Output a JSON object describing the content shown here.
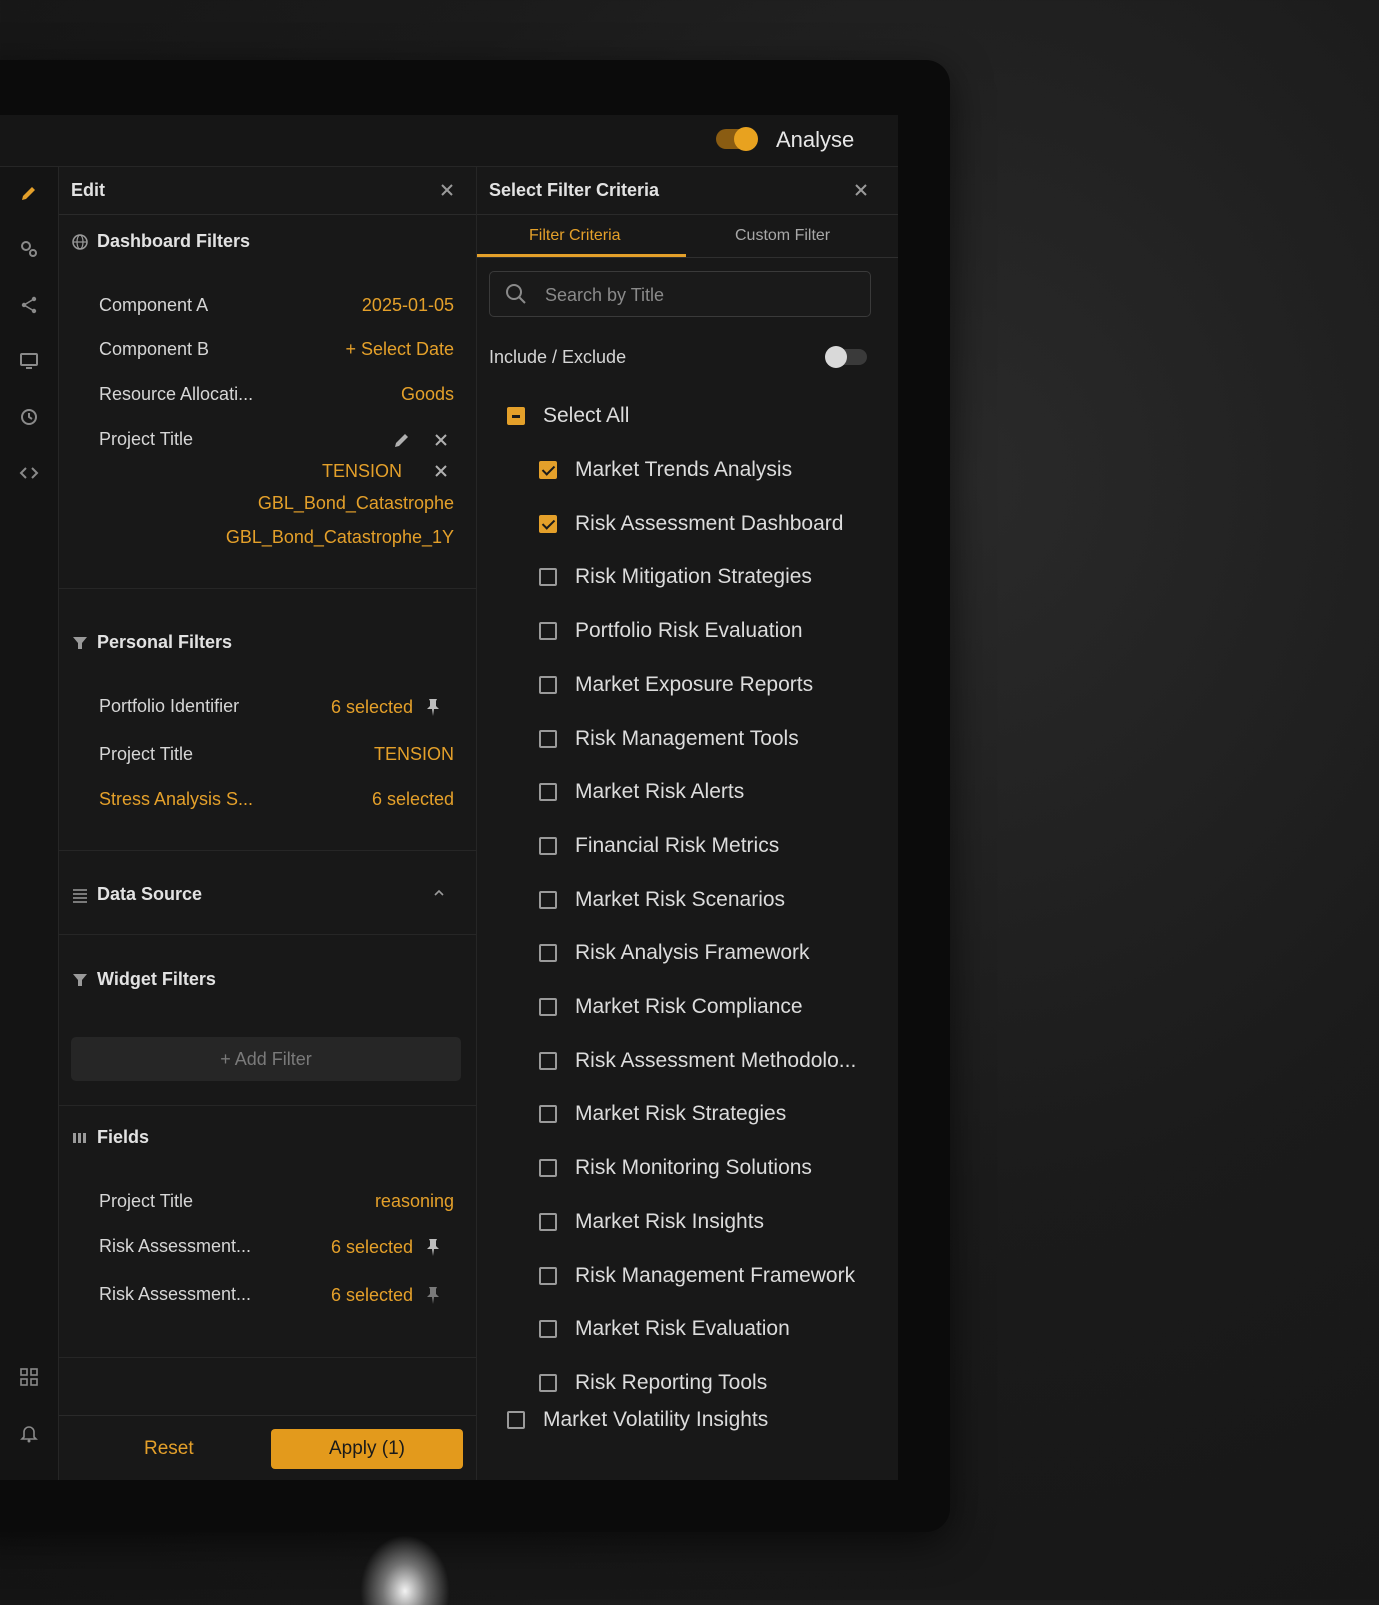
{
  "header": {
    "analyse_label": "Analyse"
  },
  "edit_panel": {
    "title": "Edit",
    "dashboard_filters": {
      "title": "Dashboard Filters",
      "rows": [
        {
          "label": "Component A",
          "value": "2025-01-05"
        },
        {
          "label": "Component B",
          "value": "+ Select Date"
        },
        {
          "label": "Resource Allocati...",
          "value": "Goods"
        },
        {
          "label": "Project Title",
          "values": [
            "TENSION",
            "GBL_Bond_Catastrophe",
            "GBL_Bond_Catastrophe_1Y"
          ]
        }
      ]
    },
    "personal_filters": {
      "title": "Personal Filters",
      "rows": [
        {
          "label": "Portfolio Identifier",
          "value": "6 selected"
        },
        {
          "label": "Project Title",
          "value": "TENSION"
        },
        {
          "label": "Stress Analysis S...",
          "value": "6 selected"
        }
      ]
    },
    "data_source": {
      "title": "Data Source"
    },
    "widget_filters": {
      "title": "Widget Filters",
      "add_label": "+ Add Filter"
    },
    "fields": {
      "title": "Fields",
      "rows": [
        {
          "label": "Project Title",
          "value": "reasoning"
        },
        {
          "label": "Risk Assessment...",
          "value": "6 selected"
        },
        {
          "label": "Risk Assessment...",
          "value": "6 selected"
        }
      ]
    },
    "footer": {
      "reset_label": "Reset",
      "apply_label": "Apply (1)"
    }
  },
  "filter_panel": {
    "title": "Select Filter Criteria",
    "tabs": [
      "Filter Criteria",
      "Custom Filter"
    ],
    "search_placeholder": "Search by Title",
    "include_exclude_label": "Include / Exclude",
    "select_all_label": "Select All",
    "items": [
      {
        "label": "Market Trends Analysis",
        "checked": true
      },
      {
        "label": "Risk Assessment Dashboard",
        "checked": true
      },
      {
        "label": "Risk Mitigation Strategies",
        "checked": false
      },
      {
        "label": "Portfolio Risk Evaluation",
        "checked": false
      },
      {
        "label": "Market Exposure Reports",
        "checked": false
      },
      {
        "label": "Risk Management Tools",
        "checked": false
      },
      {
        "label": "Market Risk Alerts",
        "checked": false
      },
      {
        "label": "Financial Risk Metrics",
        "checked": false
      },
      {
        "label": "Market Risk Scenarios",
        "checked": false
      },
      {
        "label": "Risk Analysis Framework",
        "checked": false
      },
      {
        "label": "Market Risk Compliance",
        "checked": false
      },
      {
        "label": "Risk Assessment Methodolo...",
        "checked": false
      },
      {
        "label": "Market Risk Strategies",
        "checked": false
      },
      {
        "label": "Risk Monitoring Solutions",
        "checked": false
      },
      {
        "label": "Market Risk Insights",
        "checked": false
      },
      {
        "label": "Risk Management Framework",
        "checked": false
      },
      {
        "label": "Market Risk Evaluation",
        "checked": false
      },
      {
        "label": "Risk Reporting Tools",
        "checked": false
      }
    ],
    "last_item": {
      "label": "Market Volatility Insights",
      "checked": false
    }
  },
  "colors": {
    "accent": "#e4a02a",
    "background": "#161616"
  }
}
